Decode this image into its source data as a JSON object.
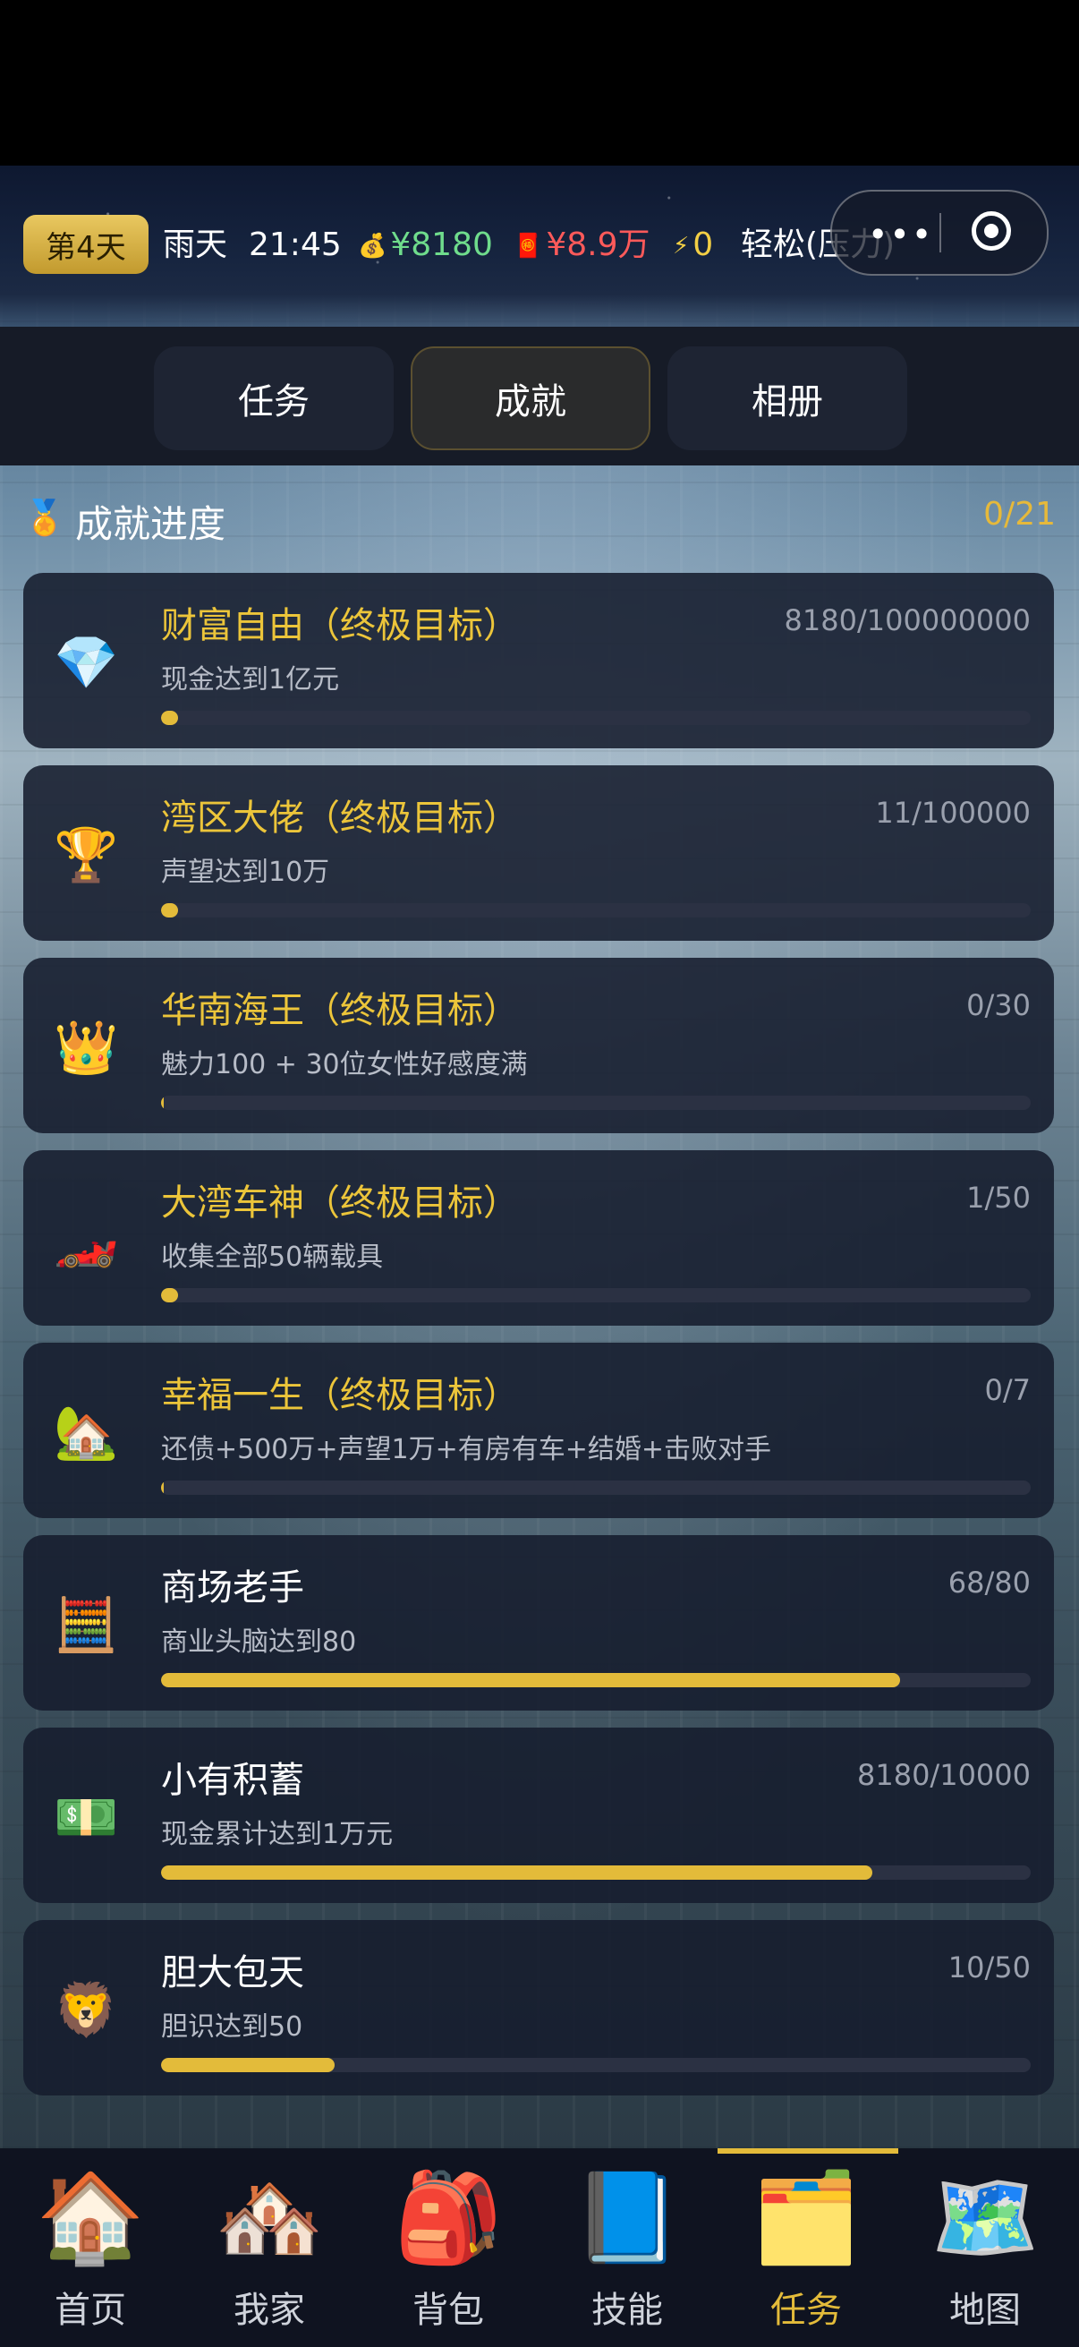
{
  "status": {
    "day": "第4天",
    "weather": "雨天",
    "time": "21:45",
    "cash_icon": "money-bag-icon",
    "cash": "¥8180",
    "debt_icon": "red-envelope-icon",
    "debt": "¥8.9万",
    "energy_icon": "lightning-icon",
    "energy": "0",
    "stress": "轻松(压力)"
  },
  "capsule": {
    "more": "•••"
  },
  "tabs": [
    {
      "label": "任务",
      "active": false
    },
    {
      "label": "成就",
      "active": true
    },
    {
      "label": "相册",
      "active": false
    }
  ],
  "section": {
    "medal": "🏅",
    "title": "成就进度",
    "count": "0/21"
  },
  "achievements": [
    {
      "icon": "💎",
      "icon_name": "diamond-icon",
      "name": "财富自由（终极目标）",
      "ultimate": true,
      "progress": "8180/100000000",
      "desc": "现金达到1亿元",
      "fraction": 0.0001
    },
    {
      "icon": "🏆",
      "icon_name": "trophy-icon",
      "name": "湾区大佬（终极目标）",
      "ultimate": true,
      "progress": "11/100000",
      "desc": "声望达到10万",
      "fraction": 0.0001
    },
    {
      "icon": "👑",
      "icon_name": "crown-icon",
      "name": "华南海王（终极目标）",
      "ultimate": true,
      "progress": "0/30",
      "desc": "魅力100 + 30位女性好感度满",
      "fraction": 0
    },
    {
      "icon": "🏎️",
      "icon_name": "race-car-icon",
      "name": "大湾车神（终极目标）",
      "ultimate": true,
      "progress": "1/50",
      "desc": "收集全部50辆载具",
      "fraction": 0.02
    },
    {
      "icon": "🏡",
      "icon_name": "house-icon",
      "name": "幸福一生（终极目标）",
      "ultimate": true,
      "progress": "0/7",
      "desc": "还债+500万+声望1万+有房有车+结婚+击败对手",
      "fraction": 0
    },
    {
      "icon": "🧮",
      "icon_name": "abacus-icon",
      "name": "商场老手",
      "ultimate": false,
      "progress": "68/80",
      "desc": "商业头脑达到80",
      "fraction": 0.85
    },
    {
      "icon": "💵",
      "icon_name": "cash-icon",
      "name": "小有积蓄",
      "ultimate": false,
      "progress": "8180/10000",
      "desc": "现金累计达到1万元",
      "fraction": 0.818
    },
    {
      "icon": "🦁",
      "icon_name": "lion-icon",
      "name": "胆大包天",
      "ultimate": false,
      "progress": "10/50",
      "desc": "胆识达到50",
      "fraction": 0.2
    }
  ],
  "nav": [
    {
      "label": "首页",
      "icon": "🏠",
      "icon_name": "home-icon",
      "active": false
    },
    {
      "label": "我家",
      "icon": "🏘️",
      "icon_name": "my-house-icon",
      "active": false
    },
    {
      "label": "背包",
      "icon": "🎒",
      "icon_name": "backpack-icon",
      "active": false
    },
    {
      "label": "技能",
      "icon": "📘",
      "icon_name": "skill-book-icon",
      "active": false
    },
    {
      "label": "任务",
      "icon": "🗂️",
      "icon_name": "task-photos-icon",
      "active": true
    },
    {
      "label": "地图",
      "icon": "🗺️",
      "icon_name": "map-icon",
      "active": false
    }
  ],
  "colors": {
    "gold": "#e3bb3a",
    "cash": "#6fdc8c",
    "debt": "#ff5a5a"
  }
}
